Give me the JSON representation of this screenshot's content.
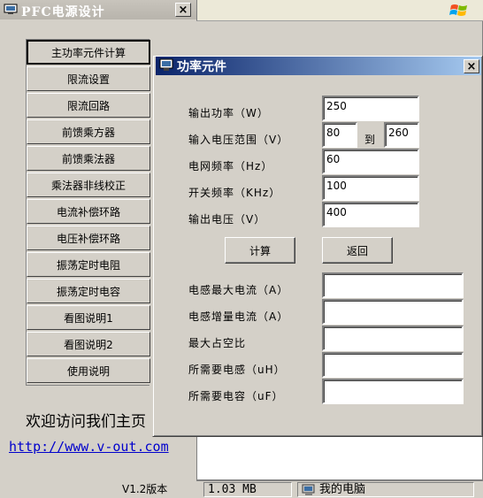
{
  "main_window": {
    "title": "PFC电源设计",
    "close_glyph": "×",
    "nav": [
      {
        "label": "主功率元件计算",
        "active": true
      },
      {
        "label": "限流设置"
      },
      {
        "label": "限流回路"
      },
      {
        "label": "前馈乘方器"
      },
      {
        "label": "前馈乘法器"
      },
      {
        "label": "乘法器非线校正"
      },
      {
        "label": "电流补偿环路"
      },
      {
        "label": "电压补偿环路"
      },
      {
        "label": "振荡定时电阻"
      },
      {
        "label": "振荡定时电容"
      },
      {
        "label": "看图说明1"
      },
      {
        "label": "看图说明2"
      },
      {
        "label": "使用说明"
      }
    ],
    "welcome_text": "欢迎访问我们主页",
    "link_text": "http://www.v-out.com",
    "version": "V1.2版本"
  },
  "status_bar": {
    "size": "1.03 MB",
    "location": "我的电脑"
  },
  "dialog": {
    "title": "功率元件",
    "close_glyph": "×",
    "inputs": {
      "output_power": {
        "label": "输出功率（W）",
        "value": "250"
      },
      "input_voltage": {
        "label": "输入电压范围（V）",
        "min": "80",
        "to": "到",
        "max": "260"
      },
      "grid_freq": {
        "label": "电网频率（Hz）",
        "value": "60"
      },
      "switch_freq": {
        "label": "开关频率（KHz）",
        "value": "100"
      },
      "output_voltage": {
        "label": "输出电压（V）",
        "value": "400"
      }
    },
    "calc_label": "计算",
    "back_label": "返回",
    "outputs": {
      "max_inductor_current": {
        "label": "电感最大电流（A）",
        "value": ""
      },
      "inductor_ripple": {
        "label": "电感增量电流（A）",
        "value": ""
      },
      "max_duty": {
        "label": "最大占空比",
        "value": ""
      },
      "inductance": {
        "label": "所需要电感（uH）",
        "value": ""
      },
      "capacitance": {
        "label": "所需要电容（uF）",
        "value": ""
      }
    }
  }
}
